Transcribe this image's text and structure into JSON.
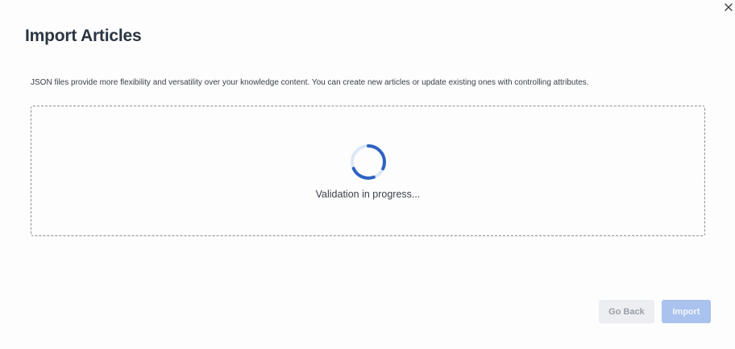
{
  "dialog": {
    "title": "Import Articles",
    "description": "JSON files provide more flexibility and versatility over your knowledge content. You can create new articles or update existing ones with controlling attributes.",
    "close_icon": "close-icon"
  },
  "dropzone": {
    "status": "Validation in progress...",
    "spinner_icon": "loading-spinner-icon"
  },
  "footer": {
    "back_label": "Go Back",
    "import_label": "Import"
  },
  "colors": {
    "spinner_active": "#2f62c2",
    "spinner_track": "#dce6f5",
    "import_button_bg": "#a9c2ee",
    "back_button_bg": "#eceef1",
    "title": "#2b3542"
  }
}
